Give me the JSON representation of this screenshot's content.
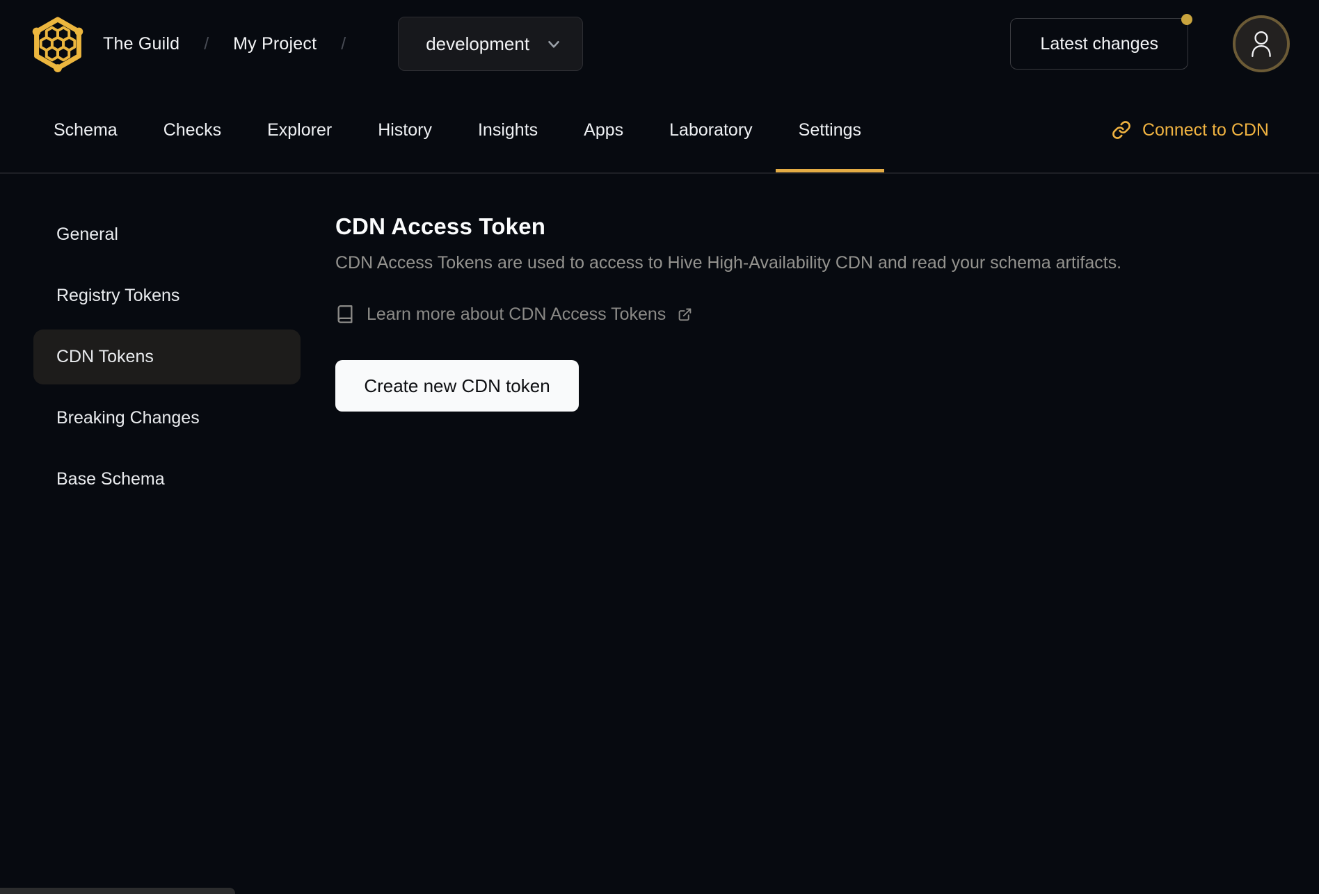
{
  "header": {
    "breadcrumb": {
      "org": "The Guild",
      "separator": "/",
      "project": "My Project"
    },
    "target_select": {
      "value": "development",
      "chevron_icon": "chevron-down-icon"
    },
    "latest_changes": {
      "label": "Latest changes",
      "has_notification_dot": true
    },
    "logo_icon": "hive-honeycomb-logo",
    "avatar_icon": "user-icon"
  },
  "nav": {
    "tabs": [
      {
        "label": "Schema",
        "active": false
      },
      {
        "label": "Checks",
        "active": false
      },
      {
        "label": "Explorer",
        "active": false
      },
      {
        "label": "History",
        "active": false
      },
      {
        "label": "Insights",
        "active": false
      },
      {
        "label": "Apps",
        "active": false
      },
      {
        "label": "Laboratory",
        "active": false
      },
      {
        "label": "Settings",
        "active": true
      }
    ],
    "connect_cdn": {
      "label": "Connect to CDN",
      "icon": "link-icon"
    }
  },
  "sidebar": {
    "items": [
      {
        "label": "General",
        "active": false
      },
      {
        "label": "Registry Tokens",
        "active": false
      },
      {
        "label": "CDN Tokens",
        "active": true
      },
      {
        "label": "Breaking Changes",
        "active": false
      },
      {
        "label": "Base Schema",
        "active": false
      }
    ]
  },
  "main": {
    "title": "CDN Access Token",
    "description": "CDN Access Tokens are used to access to Hive High-Availability CDN and read your schema artifacts.",
    "learn_more": {
      "label": "Learn more about CDN Access Tokens",
      "leading_icon": "book-icon",
      "trailing_icon": "external-link-icon"
    },
    "create_button_label": "Create new CDN token"
  },
  "colors": {
    "accent_gold": "#f0b341",
    "background": "#070a10",
    "active_item_bg": "#1d1c1b",
    "button_bg": "#f9fafb",
    "muted_text": "#94938f"
  }
}
